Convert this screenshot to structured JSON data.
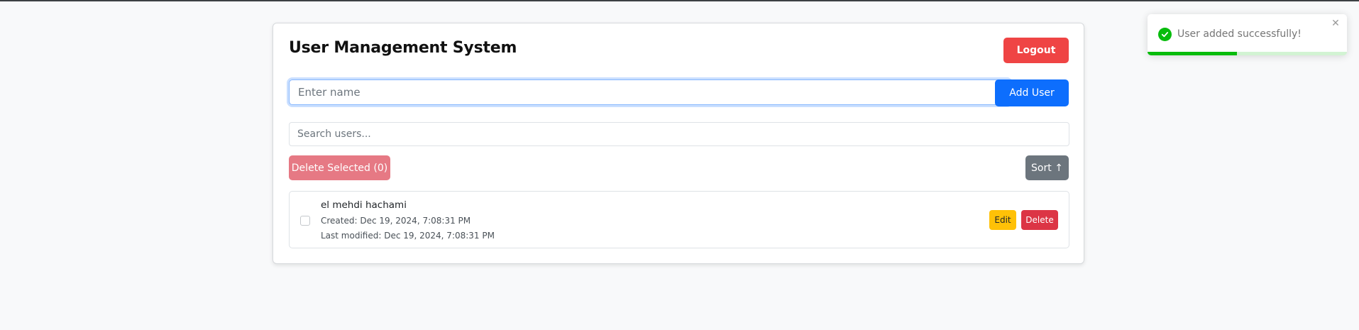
{
  "app": {
    "title": "User Management System",
    "logout_label": "Logout"
  },
  "add_user": {
    "placeholder": "Enter name",
    "value": "",
    "button_label": "Add User"
  },
  "search": {
    "placeholder": "Search users..."
  },
  "toolbar": {
    "delete_selected_label": "Delete Selected (0)",
    "sort_label": "Sort ↑"
  },
  "users": [
    {
      "name": "el mehdi hachami",
      "created": "Created: Dec 19, 2024, 7:08:31 PM",
      "modified": "Last modified: Dec 19, 2024, 7:08:31 PM",
      "selected": false,
      "edit_label": "Edit",
      "delete_label": "Delete"
    }
  ],
  "toast": {
    "message": "User added successfully!",
    "type": "success",
    "close_icon": "close-icon",
    "progress": 0.45
  },
  "colors": {
    "logout": "#ef4444",
    "primary": "#0d6efd",
    "danger_disabled": "#e67984",
    "secondary": "#6c757d",
    "warning": "#ffc107",
    "danger": "#dc3545",
    "success": "#07bc0c"
  }
}
